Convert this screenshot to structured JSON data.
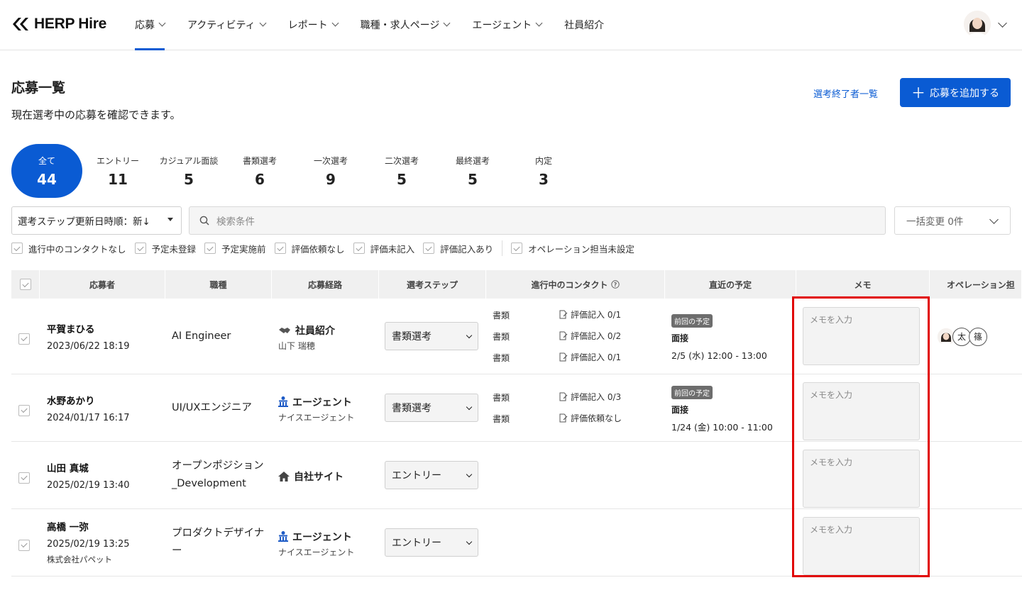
{
  "header": {
    "logo": "HERP Hire",
    "nav": [
      {
        "label": "応募",
        "chevron": true,
        "active": true
      },
      {
        "label": "アクティビティ",
        "chevron": true
      },
      {
        "label": "レポート",
        "chevron": true
      },
      {
        "label": "職種・求人ページ",
        "chevron": true
      },
      {
        "label": "エージェント",
        "chevron": true
      },
      {
        "label": "社員紹介",
        "chevron": false
      }
    ]
  },
  "page": {
    "title": "応募一覧",
    "subtitle": "現在選考中の応募を確認できます。",
    "ended_link": "選考終了者一覧",
    "add_button": "応募を追加する"
  },
  "steps": [
    {
      "label": "全て",
      "count": "44",
      "active": true
    },
    {
      "label": "エントリー",
      "count": "11"
    },
    {
      "label": "カジュアル面談",
      "count": "5"
    },
    {
      "label": "書類選考",
      "count": "6"
    },
    {
      "label": "一次選考",
      "count": "9"
    },
    {
      "label": "二次選考",
      "count": "5"
    },
    {
      "label": "最終選考",
      "count": "5"
    },
    {
      "label": "内定",
      "count": "3"
    }
  ],
  "filters": {
    "sort": "選考ステップ更新日時順：新↓",
    "search_placeholder": "検索条件",
    "bulk": "一括変更 0件",
    "checks": [
      "進行中のコンタクトなし",
      "予定未登録",
      "予定実施前",
      "評価依頼なし",
      "評価未記入",
      "評価記入あり"
    ],
    "check_extra": "オペレーション担当未設定"
  },
  "table": {
    "headers": [
      "応募者",
      "職種",
      "応募経路",
      "選考ステップ",
      "進行中のコンタクト",
      "直近の予定",
      "メモ",
      "オペレーション担"
    ],
    "memo_placeholder": "メモを入力",
    "rows": [
      {
        "name": "平賀まひる",
        "date": "2023/06/22 18:19",
        "company": "",
        "job": [
          "AI Engineer"
        ],
        "route": "社員紹介",
        "route_icon": "handshake-icon",
        "route_sub": "山下 瑞穂",
        "step": "書類選考",
        "contacts": [
          {
            "type": "書類",
            "eval": "評価記入 0/1"
          },
          {
            "type": "書類",
            "eval": "評価記入 0/2"
          },
          {
            "type": "書類",
            "eval": "評価記入 0/1"
          }
        ],
        "schedule": {
          "badge": "前回の予定",
          "type": "面接",
          "time": "2/5 (水) 12:00 - 13:00"
        },
        "ops": [
          "太",
          "篠"
        ]
      },
      {
        "name": "水野あかり",
        "date": "2024/01/17 16:17",
        "company": "",
        "job": [
          "UI/UXエンジニア"
        ],
        "route": "エージェント",
        "route_icon": "building-icon",
        "route_sub": "ナイスエージェント",
        "step": "書類選考",
        "contacts": [
          {
            "type": "書類",
            "eval": "評価記入 0/3"
          },
          {
            "type": "書類",
            "eval": "評価依頼なし"
          }
        ],
        "schedule": {
          "badge": "前回の予定",
          "type": "面接",
          "time": "1/24 (金) 10:00 - 11:00"
        },
        "ops": []
      },
      {
        "name": "山田 真城",
        "date": "2025/02/19 13:40",
        "company": "",
        "job": [
          "オープンポジション",
          "_Development"
        ],
        "route": "自社サイト",
        "route_icon": "home-icon",
        "route_sub": "",
        "step": "エントリー",
        "contacts": [],
        "schedule": null,
        "ops": []
      },
      {
        "name": "高橋 一弥",
        "date": "2025/02/19 13:25",
        "company": "株式会社パペット",
        "job": [
          "プロダクトデザイナ",
          "ー"
        ],
        "route": "エージェント",
        "route_icon": "building-icon",
        "route_sub": "ナイスエージェント",
        "step": "エントリー",
        "contacts": [],
        "schedule": null,
        "ops": []
      }
    ]
  },
  "colors": {
    "accent": "#0a5bd3",
    "highlight": "#e10000"
  }
}
